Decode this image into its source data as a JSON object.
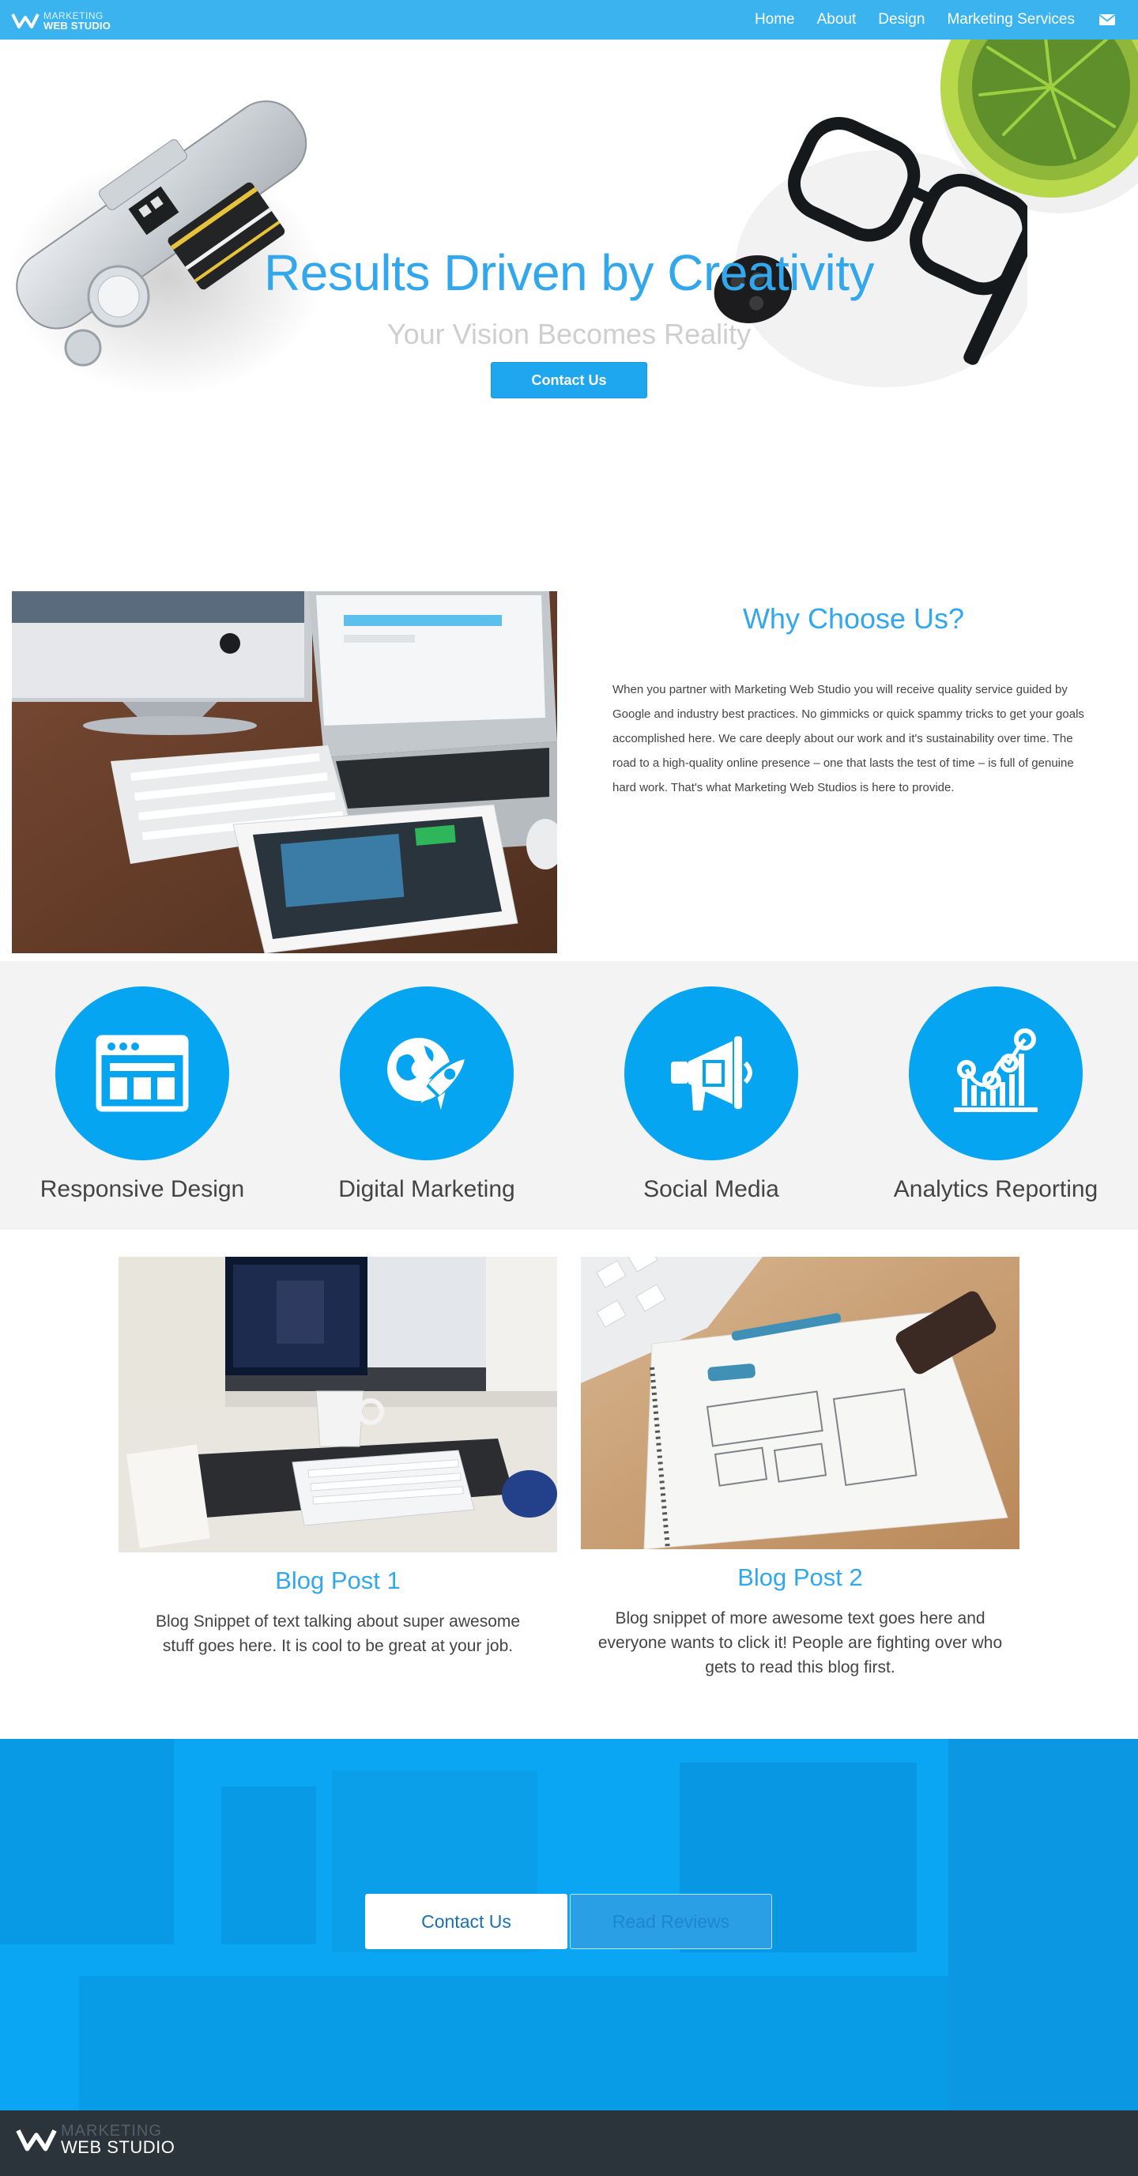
{
  "nav": {
    "logo": {
      "line1": "MARKETING",
      "line2": "WEB STUDIO"
    },
    "links": [
      "Home",
      "About",
      "Design",
      "Marketing Services"
    ],
    "mail_icon": "envelope-icon",
    "background": "#3ab3ef"
  },
  "hero": {
    "title": "Results Driven by Creativity",
    "subtitle": "Your Vision Becomes Reality",
    "button": "Contact Us"
  },
  "why": {
    "title": "Why Choose Us?",
    "text": "When you partner with Marketing Web Studio you will receive quality service guided by Google and industry best practices. No gimmicks or quick spammy tricks to get your goals accomplished here. We care deeply about our work and it's sustainability over time. The road to a high-quality online presence – one that lasts the test of time – is full of genuine hard work. That's what Marketing Web Studios is here to provide."
  },
  "services": [
    {
      "label": "Responsive Design",
      "icon": "browser-window-icon"
    },
    {
      "label": "Digital Marketing",
      "icon": "rocket-globe-icon"
    },
    {
      "label": "Social Media",
      "icon": "megaphone-icon"
    },
    {
      "label": "Analytics Reporting",
      "icon": "analytics-chart-icon"
    }
  ],
  "blog": [
    {
      "title": "Blog Post 1",
      "text": "Blog Snippet of text talking about super awesome stuff goes here. It is cool to be great at your job."
    },
    {
      "title": "Blog Post 2",
      "text": "Blog snippet of more awesome text goes here and everyone wants to click it! People are fighting over who gets to read this blog first."
    }
  ],
  "cta": {
    "primary": "Contact Us",
    "secondary": "Read Reviews"
  },
  "footer": {
    "logo": {
      "line1": "MARKETING",
      "line2": "WEB STUDIO"
    }
  },
  "colors": {
    "accent": "#32a7ec",
    "brand_blue": "#05a5f2",
    "footer": "#2b333b"
  }
}
